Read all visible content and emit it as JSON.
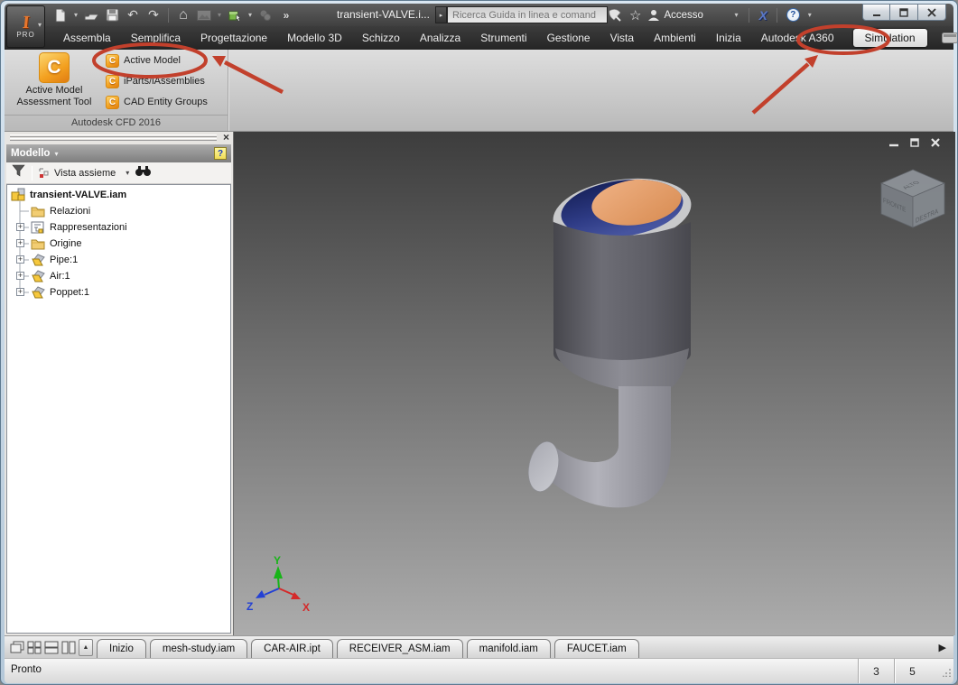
{
  "window": {
    "title": "transient-VALVE.i...",
    "logo_text": "PRO",
    "search_placeholder": "Ricerca Guida in linea e comand",
    "account_label": "Accesso",
    "exchange_label": "X",
    "help_label": "?"
  },
  "ribbon": {
    "tabs": [
      "Assembla",
      "Semplifica",
      "Progettazione",
      "Modello 3D",
      "Schizzo",
      "Analizza",
      "Strumenti",
      "Gestione",
      "Vista",
      "Ambienti",
      "Inizia",
      "Autodesk A360",
      "Simulation"
    ],
    "active_tab": "Simulation",
    "panel": {
      "big_button_line1": "Active Model",
      "big_button_line2": "Assessment Tool",
      "small_buttons": [
        "Active Model",
        "iParts/iAssemblies",
        "CAD Entity Groups"
      ],
      "group_label": "Autodesk CFD 2016"
    }
  },
  "browser": {
    "header": "Modello",
    "view_selector": "Vista assieme",
    "tree": [
      "transient-VALVE.iam",
      "Relazioni",
      "Rappresentazioni",
      "Origine",
      "Pipe:1",
      "Air:1",
      "Poppet:1"
    ]
  },
  "viewport": {
    "viewcube": {
      "top": "ALTO",
      "front": "FRONTE",
      "right": "DESTRA"
    },
    "axes": {
      "x": "X",
      "y": "Y",
      "z": "Z"
    }
  },
  "document_tabs": [
    "Inizio",
    "mesh-study.iam",
    "CAR-AIR.ipt",
    "RECEIVER_ASM.iam",
    "manifold.iam",
    "FAUCET.iam"
  ],
  "statusbar": {
    "message": "Pronto",
    "counts": [
      "3",
      "5"
    ]
  },
  "icons": {
    "dropdown": "▾",
    "undo": "↶",
    "redo": "↷",
    "home": "⌂",
    "star": "☆",
    "overflow": "»",
    "search_go": "▸",
    "up_arrow": "▲",
    "scroll_right": "▶",
    "expand": "+",
    "close": "×",
    "cfd_letter": "C"
  },
  "colors": {
    "annotation_red": "#c2402c",
    "cfd_orange": "#f3a01f",
    "titlebar_gray": "#4a4a4a",
    "viewport_top": "#3d3d3d",
    "viewport_bottom": "#acacac",
    "model_blue": "#2e3b85",
    "poppet_orange": "#e5a06a",
    "axis_x": "#d42a2a",
    "axis_y": "#18b418",
    "axis_z": "#2441d4",
    "active_tab_bg": "#ededed"
  }
}
